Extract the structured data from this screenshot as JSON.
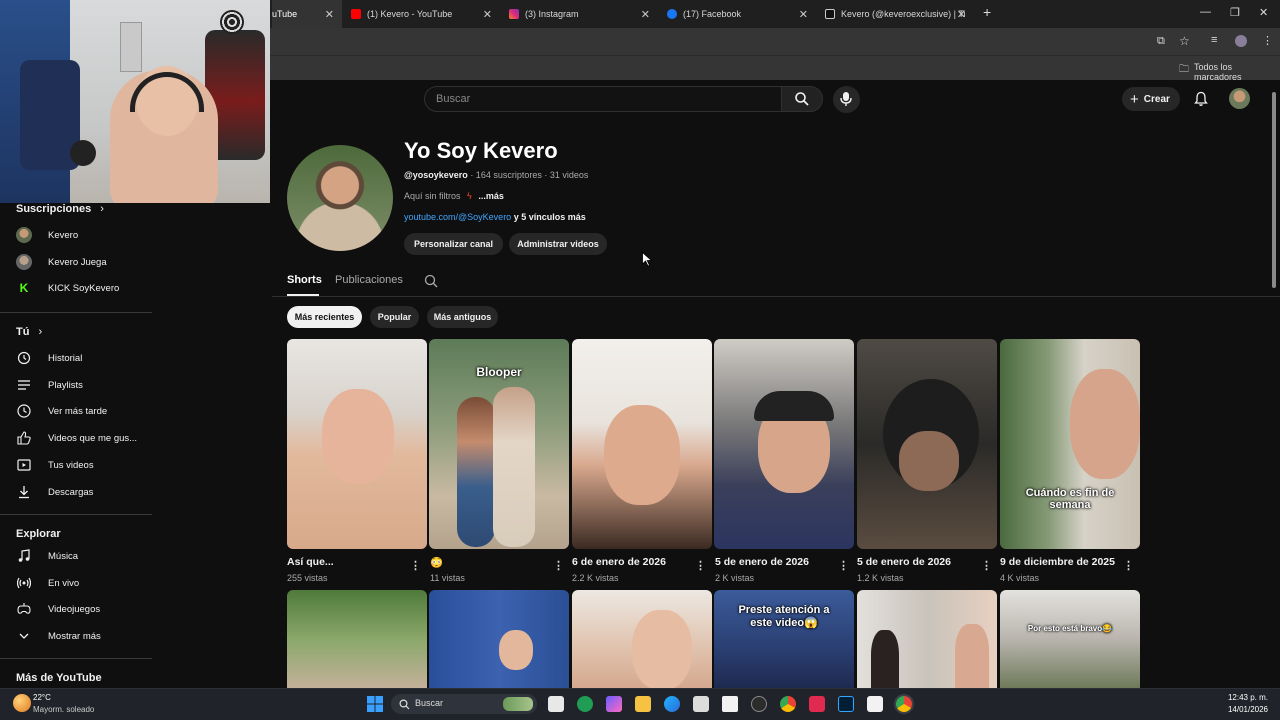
{
  "browser": {
    "tabs": [
      {
        "label": "uTube",
        "color": "#ff0000"
      },
      {
        "label": "(1) Kevero - YouTube",
        "color": "#ff0000"
      },
      {
        "label": "(3) Instagram",
        "color": "#d6249f"
      },
      {
        "label": "(17) Facebook",
        "color": "#1877f2"
      },
      {
        "label": "Kevero (@keveroexclusive) | Ti",
        "color": "#ffffff"
      }
    ],
    "bookmarks_label": "Todos los marcadores"
  },
  "header": {
    "search_placeholder": "Buscar",
    "create_label": "Crear"
  },
  "sidebar": {
    "subscriptions_title": "Suscripciones",
    "subscriptions": [
      {
        "label": "Kevero"
      },
      {
        "label": "Kevero Juega"
      },
      {
        "label": "KICK SoyKevero"
      }
    ],
    "you_title": "Tú",
    "you_items": [
      {
        "label": "Historial",
        "icon": "history-icon"
      },
      {
        "label": "Playlists",
        "icon": "playlists-icon"
      },
      {
        "label": "Ver más tarde",
        "icon": "watch-later-icon"
      },
      {
        "label": "Videos que me gus...",
        "icon": "like-icon"
      },
      {
        "label": "Tus videos",
        "icon": "your-videos-icon"
      },
      {
        "label": "Descargas",
        "icon": "download-icon"
      }
    ],
    "explore_title": "Explorar",
    "explore_items": [
      {
        "label": "Música",
        "icon": "music-icon"
      },
      {
        "label": "En vivo",
        "icon": "live-icon"
      },
      {
        "label": "Videojuegos",
        "icon": "gaming-icon"
      },
      {
        "label": "Mostrar más",
        "icon": "chevron-down-icon"
      }
    ],
    "more_title": "Más de YouTube"
  },
  "channel": {
    "name": "Yo Soy Kevero",
    "handle": "@yosoykevero",
    "stats": " · 164 suscriptores · 31 videos",
    "description": "Aquí sin filtros",
    "more": "...más",
    "link": "youtube.com/@SoyKevero",
    "links_more": " y 5 vínculos más",
    "customize_label": "Personalizar canal",
    "manage_label": "Administrar videos"
  },
  "tabs": [
    "Shorts",
    "Publicaciones"
  ],
  "filters": [
    "Más recientes",
    "Popular",
    "Más antiguos"
  ],
  "shorts_row1": [
    {
      "title": "Así que...",
      "views": "255 vistas",
      "overlay": ""
    },
    {
      "title": "😳",
      "views": "11 vistas",
      "overlay": "Blooper"
    },
    {
      "title": "6 de enero de 2026",
      "views": "2.2 K vistas",
      "overlay": ""
    },
    {
      "title": "5 de enero de 2026",
      "views": "2 K vistas",
      "overlay": ""
    },
    {
      "title": "5 de enero de 2026",
      "views": "1.2 K vistas",
      "overlay": ""
    },
    {
      "title": "9 de diciembre de 2025",
      "views": "4 K vistas",
      "overlay": "Cuándo es fin de semana"
    }
  ],
  "shorts_row2_overlays": [
    "",
    "",
    "",
    "Preste atención a este video😱",
    "",
    "Por esto está bravo😂"
  ],
  "taskbar": {
    "weather_temp": "22°C",
    "weather_desc": "Mayorm. soleado",
    "search_label": "Buscar",
    "time": "12:43 p. m.",
    "date": "14/01/2026"
  }
}
